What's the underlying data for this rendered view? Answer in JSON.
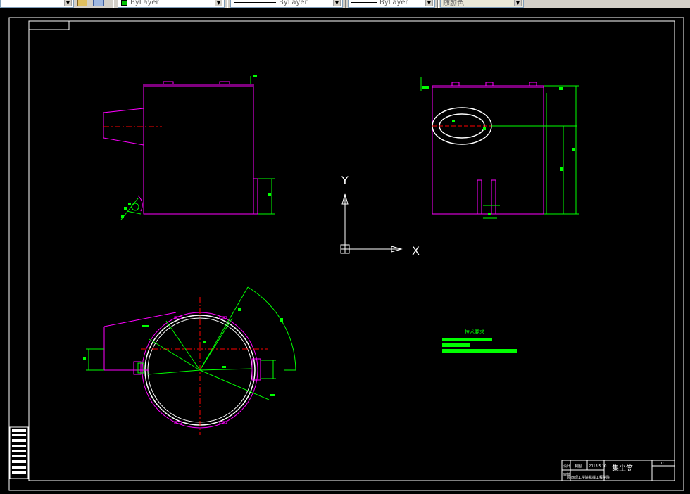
{
  "toolbar": {
    "layer_color_label": "ByLayer",
    "linetype_label": "ByLayer",
    "lineweight_label": "ByLayer",
    "plotstyle_label": "随颜色",
    "icons": [
      "layer-state-icon",
      "layer-stack-icon"
    ]
  },
  "drawing": {
    "ucs_x_label": "X",
    "ucs_y_label": "Y",
    "notes_title": "技术要求",
    "title_block": {
      "part_name": "集尘筒",
      "scale": "1:1",
      "school": "陕西理工学院机械工程学院",
      "cell_a": "制图",
      "cell_b": "设计",
      "cell_c": "审核",
      "cell_d": "2013.5.10"
    }
  },
  "colors": {
    "background": "#000000",
    "outline": "#ff00ff",
    "dimension": "#00ff00",
    "centerline": "#ff0000",
    "frame": "#ffffff",
    "toolbar": "#d4d0c8"
  }
}
